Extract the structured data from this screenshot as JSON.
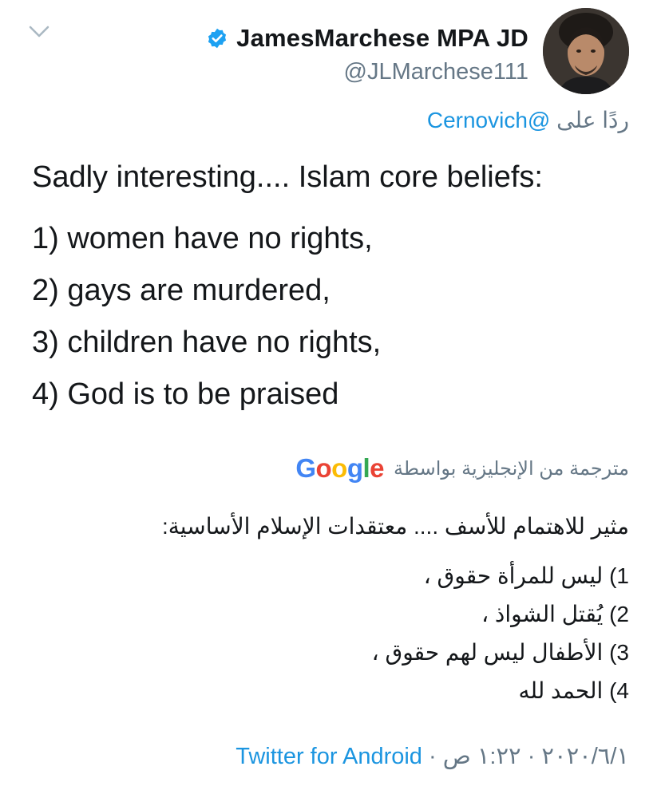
{
  "header": {
    "display_name": "JamesMarchese MPA JD",
    "handle": "@JLMarchese111",
    "verified_icon": "verified-badge-icon",
    "menu_icon": "chevron-down-icon"
  },
  "reply": {
    "prefix": "ردًا على",
    "mention": "@Cernovich"
  },
  "tweet": {
    "intro": "Sadly interesting.... Islam core beliefs:",
    "lines": [
      "1) women have no rights,",
      "2) gays are murdered,",
      "3) children have no rights,",
      "4) God is to be praised"
    ]
  },
  "translation": {
    "label": "مترجمة من الإنجليزية بواسطة",
    "provider_letters": [
      "G",
      "o",
      "o",
      "g",
      "l",
      "e"
    ],
    "provider_colors": [
      "#4285F4",
      "#EA4335",
      "#FBBC05",
      "#4285F4",
      "#34A853",
      "#EA4335"
    ],
    "intro": "مثير للاهتمام للأسف .... معتقدات الإسلام الأساسية:",
    "lines": [
      "1) ليس للمرأة حقوق ،",
      "2) يُقتل الشواذ ،",
      "3) الأطفال ليس لهم حقوق ،",
      "4) الحمد لله"
    ]
  },
  "meta": {
    "datetime": "٢٠٢٠/٦/١ · ١:٢٢ ص",
    "separator": " · ",
    "app": "Twitter for Android"
  },
  "colors": {
    "link": "#1b95e0",
    "secondary_text": "#657786",
    "primary_text": "#14171a"
  }
}
